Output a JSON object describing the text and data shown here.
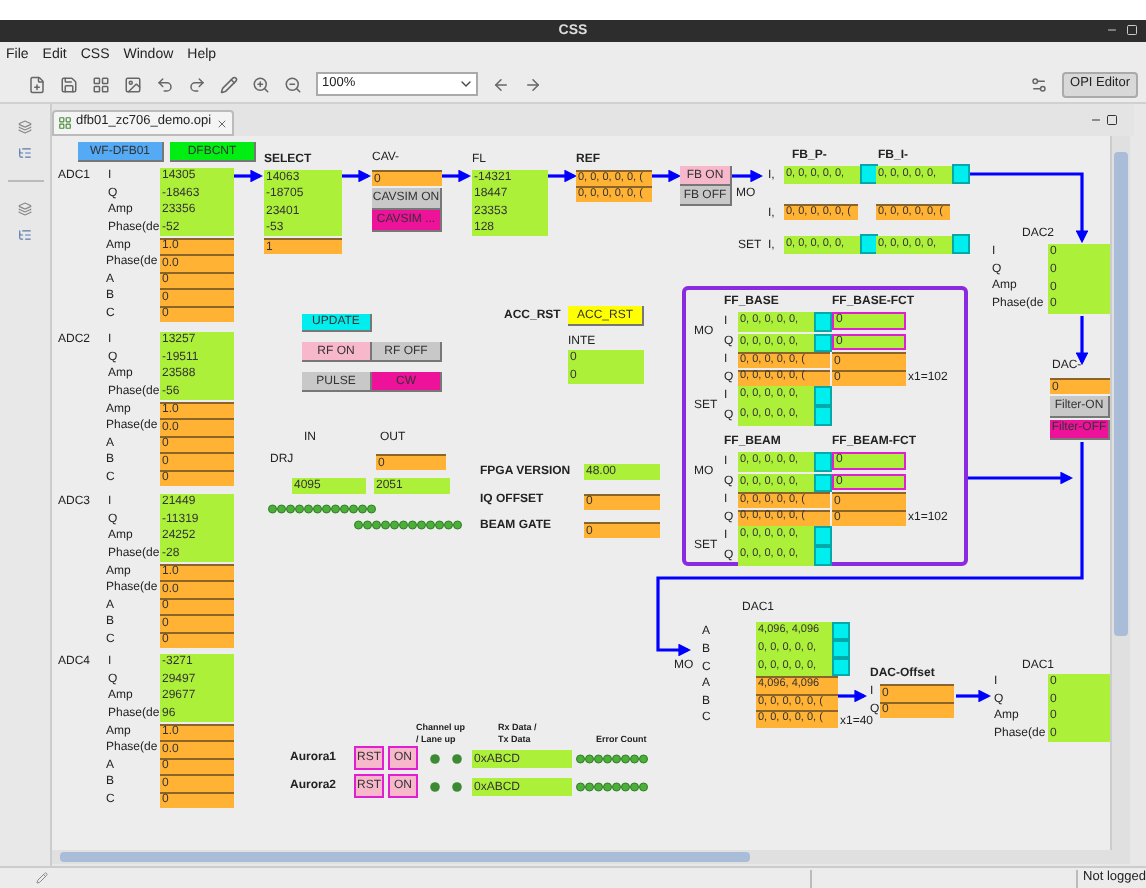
{
  "window": {
    "title": "CSS"
  },
  "menu": [
    "File",
    "Edit",
    "CSS",
    "Window",
    "Help"
  ],
  "toolbar": {
    "zoom": "100%",
    "perspective": "OPI Editor"
  },
  "editor_tab": {
    "label": "dfb01_zc706_demo.opi"
  },
  "display": {
    "nav_buttons": [
      {
        "label": "WF-DFB01",
        "color": "#55aaf5"
      },
      {
        "label": "DFBCNT",
        "color": "#00ee11"
      }
    ],
    "adc": [
      {
        "name": "ADC1",
        "readings": [
          {
            "label": "I",
            "value": "14305"
          },
          {
            "label": "Q",
            "value": "-18463"
          },
          {
            "label": "Amp",
            "value": "23356"
          },
          {
            "label": "Phase(de",
            "value": "-52"
          }
        ],
        "settings": [
          {
            "label": "Amp",
            "value": "1.0"
          },
          {
            "label": "Phase(de",
            "value": "0.0"
          },
          {
            "label": "A",
            "value": "0"
          },
          {
            "label": "B",
            "value": "0"
          },
          {
            "label": "C",
            "value": "0"
          }
        ]
      },
      {
        "name": "ADC2",
        "readings": [
          {
            "label": "I",
            "value": "13257"
          },
          {
            "label": "Q",
            "value": "-19511"
          },
          {
            "label": "Amp",
            "value": "23588"
          },
          {
            "label": "Phase(de",
            "value": "-56"
          }
        ],
        "settings": [
          {
            "label": "Amp",
            "value": "1.0"
          },
          {
            "label": "Phase(de",
            "value": "0.0"
          },
          {
            "label": "A",
            "value": "0"
          },
          {
            "label": "B",
            "value": "0"
          },
          {
            "label": "C",
            "value": "0"
          }
        ]
      },
      {
        "name": "ADC3",
        "readings": [
          {
            "label": "I",
            "value": "21449"
          },
          {
            "label": "Q",
            "value": "-11319"
          },
          {
            "label": "Amp",
            "value": "24252"
          },
          {
            "label": "Phase(de",
            "value": "-28"
          }
        ],
        "settings": [
          {
            "label": "Amp",
            "value": "1.0"
          },
          {
            "label": "Phase(de",
            "value": "0.0"
          },
          {
            "label": "A",
            "value": "0"
          },
          {
            "label": "B",
            "value": "0"
          },
          {
            "label": "C",
            "value": "0"
          }
        ]
      },
      {
        "name": "ADC4",
        "readings": [
          {
            "label": "I",
            "value": "-3271"
          },
          {
            "label": "Q",
            "value": "29497"
          },
          {
            "label": "Amp",
            "value": "29677"
          },
          {
            "label": "Phase(de",
            "value": "96"
          }
        ],
        "settings": [
          {
            "label": "Amp",
            "value": "1.0"
          },
          {
            "label": "Phase(de",
            "value": "0.0"
          },
          {
            "label": "A",
            "value": "0"
          },
          {
            "label": "B",
            "value": "0"
          },
          {
            "label": "C",
            "value": "0"
          }
        ]
      }
    ],
    "select": {
      "title": "SELECT",
      "readings": [
        "14063",
        "-18705",
        "23401",
        "-53"
      ],
      "setting": "1"
    },
    "cav": {
      "title": "CAV-",
      "setting": "0",
      "buttons": [
        {
          "label": "CAVSIM ON",
          "color": "#c8c8c8"
        },
        {
          "label": "CAVSIM ...",
          "color": "#ee1199"
        }
      ]
    },
    "fl": {
      "title": "FL",
      "readings": [
        "-14321",
        "18447",
        "23353",
        "128"
      ]
    },
    "ref": {
      "title": "REF",
      "values": [
        "0, 0, 0, 0, 0, (",
        "0, 0, 0, 0, 0, ("
      ]
    },
    "fb_buttons": [
      {
        "label": "FB ON",
        "color": "#f7b8cc"
      },
      {
        "label": "FB OFF",
        "color": "#c8c8c8"
      }
    ],
    "fb": {
      "mode_label": "MO",
      "columns": [
        "FB_P-",
        "FB_I-"
      ],
      "rows": [
        {
          "label": "I,",
          "kind": "readback",
          "values": [
            "0, 0, 0, 0, 0,",
            "0, 0, 0, 0, 0,"
          ]
        },
        {
          "label": "I,",
          "kind": "setpoint",
          "values": [
            "0, 0, 0, 0, 0, (",
            "0, 0, 0, 0, 0, ("
          ]
        },
        {
          "group": "SET",
          "label": "I,",
          "kind": "readback",
          "values": [
            "0, 0, 0, 0, 0,",
            "0, 0, 0, 0, 0,"
          ]
        }
      ]
    },
    "dac2": {
      "title": "DAC2",
      "readings": [
        {
          "label": "I",
          "value": "0"
        },
        {
          "label": "Q",
          "value": "0"
        },
        {
          "label": "Amp",
          "value": "0"
        },
        {
          "label": "Phase(de",
          "value": "0"
        }
      ]
    },
    "dac_filter": {
      "title": "DAC-",
      "setting": "0",
      "buttons": [
        {
          "label": "Filter-ON",
          "color": "#c8c8c8"
        },
        {
          "label": "Filter-OFF",
          "color": "#ee1199"
        }
      ]
    },
    "update_button": "UPDATE",
    "rf_buttons": [
      {
        "label": "RF ON",
        "color": "#f7b8cc"
      },
      {
        "label": "RF OFF",
        "color": "#c8c8c8"
      }
    ],
    "mode_buttons": [
      {
        "label": "PULSE",
        "color": "#c8c8c8"
      },
      {
        "label": "CW",
        "color": "#ee1199"
      }
    ],
    "acc": {
      "label": "ACC_RST",
      "button": "ACC_RST"
    },
    "inte": {
      "label": "INTE",
      "values": [
        "0",
        "0"
      ]
    },
    "io": {
      "in_header": "IN",
      "out_header": "OUT",
      "label": "DRJ",
      "out_setting": "0",
      "in_value": "4095",
      "out_value": "2051"
    },
    "fpga": [
      {
        "label": "FPGA VERSION",
        "kind": "readback",
        "value": "48.00"
      },
      {
        "label": "IQ OFFSET",
        "kind": "setpoint",
        "value": "0"
      },
      {
        "label": "BEAM GATE",
        "kind": "setpoint",
        "value": "0"
      }
    ],
    "ff_blocks": [
      {
        "title": "FF_BASE",
        "fct_title": "FF_BASE-FCT",
        "groups": [
          {
            "label": "MO",
            "rows": [
              {
                "label": "I",
                "kind": "readback",
                "value": "0, 0, 0, 0, 0,"
              },
              {
                "label": "Q",
                "kind": "readback",
                "value": "0, 0, 0, 0, 0,"
              }
            ]
          },
          {
            "rows": [
              {
                "label": "I",
                "kind": "setpoint",
                "value": "0, 0, 0, 0, 0, ("
              },
              {
                "label": "Q",
                "kind": "setpoint",
                "value": "0, 0, 0, 0, 0, ("
              }
            ]
          },
          {
            "label": "SET",
            "rows": [
              {
                "label": "I",
                "kind": "readback",
                "value": "0, 0, 0, 0, 0,"
              },
              {
                "label": "Q",
                "kind": "readback",
                "value": "0, 0, 0, 0, 0,"
              }
            ]
          }
        ],
        "fct": [
          {
            "kind": "readback",
            "value": "0"
          },
          {
            "kind": "readback",
            "value": "0"
          },
          {
            "kind": "setpoint",
            "value": "0"
          },
          {
            "kind": "setpoint",
            "value": "0"
          }
        ],
        "scale": "x1=102"
      },
      {
        "title": "FF_BEAM",
        "fct_title": "FF_BEAM-FCT",
        "groups": [
          {
            "label": "MO",
            "rows": [
              {
                "label": "I",
                "kind": "readback",
                "value": "0, 0, 0, 0, 0,"
              },
              {
                "label": "Q",
                "kind": "readback",
                "value": "0, 0, 0, 0, 0,"
              }
            ]
          },
          {
            "rows": [
              {
                "label": "I",
                "kind": "setpoint",
                "value": "0, 0, 0, 0, 0, ("
              },
              {
                "label": "Q",
                "kind": "setpoint",
                "value": "0, 0, 0, 0, 0, ("
              }
            ]
          },
          {
            "label": "SET",
            "rows": [
              {
                "label": "I",
                "kind": "readback",
                "value": "0, 0, 0, 0, 0,"
              },
              {
                "label": "Q",
                "kind": "readback",
                "value": "0, 0, 0, 0, 0,"
              }
            ]
          }
        ],
        "fct": [
          {
            "kind": "readback",
            "value": "0"
          },
          {
            "kind": "readback",
            "value": "0"
          },
          {
            "kind": "setpoint",
            "value": "0"
          },
          {
            "kind": "setpoint",
            "value": "0"
          }
        ],
        "scale": "x1=102"
      }
    ],
    "dac1_input": {
      "title": "DAC1",
      "mode_label": "MO",
      "rows": [
        {
          "label": "A",
          "kind": "readback",
          "value": "4,096, 4,096"
        },
        {
          "label": "B",
          "kind": "readback",
          "value": "0, 0, 0, 0, 0,"
        },
        {
          "label": "C",
          "kind": "readback",
          "value": "0, 0, 0, 0, 0,"
        },
        {
          "label": "A",
          "kind": "setpoint",
          "value": "4,096, 4,096"
        },
        {
          "label": "B",
          "kind": "setpoint",
          "value": "0, 0, 0, 0, 0, ("
        },
        {
          "label": "C",
          "kind": "setpoint",
          "value": "0, 0, 0, 0, 0, ("
        }
      ],
      "scale": "x1=40"
    },
    "dac_offset": {
      "title": "DAC-Offset",
      "rows": [
        {
          "label": "I",
          "value": "0"
        },
        {
          "label": "Q",
          "value": "0"
        }
      ]
    },
    "dac1_output": {
      "title": "DAC1",
      "readings": [
        {
          "label": "I",
          "value": "0"
        },
        {
          "label": "Q",
          "value": "0"
        },
        {
          "label": "Amp",
          "value": "0"
        },
        {
          "label": "Phase(de",
          "value": "0"
        }
      ]
    },
    "aurora": {
      "headers": [
        "Channel up / Lane up",
        "Rx Data / Tx Data",
        "Error Count"
      ],
      "links": [
        {
          "name": "Aurora1",
          "reset": "RST",
          "enable": "ON",
          "data": "0xABCD"
        },
        {
          "name": "Aurora2",
          "reset": "RST",
          "enable": "ON",
          "data": "0xABCD"
        }
      ]
    }
  },
  "status_bar": {
    "user": "Not logged"
  }
}
